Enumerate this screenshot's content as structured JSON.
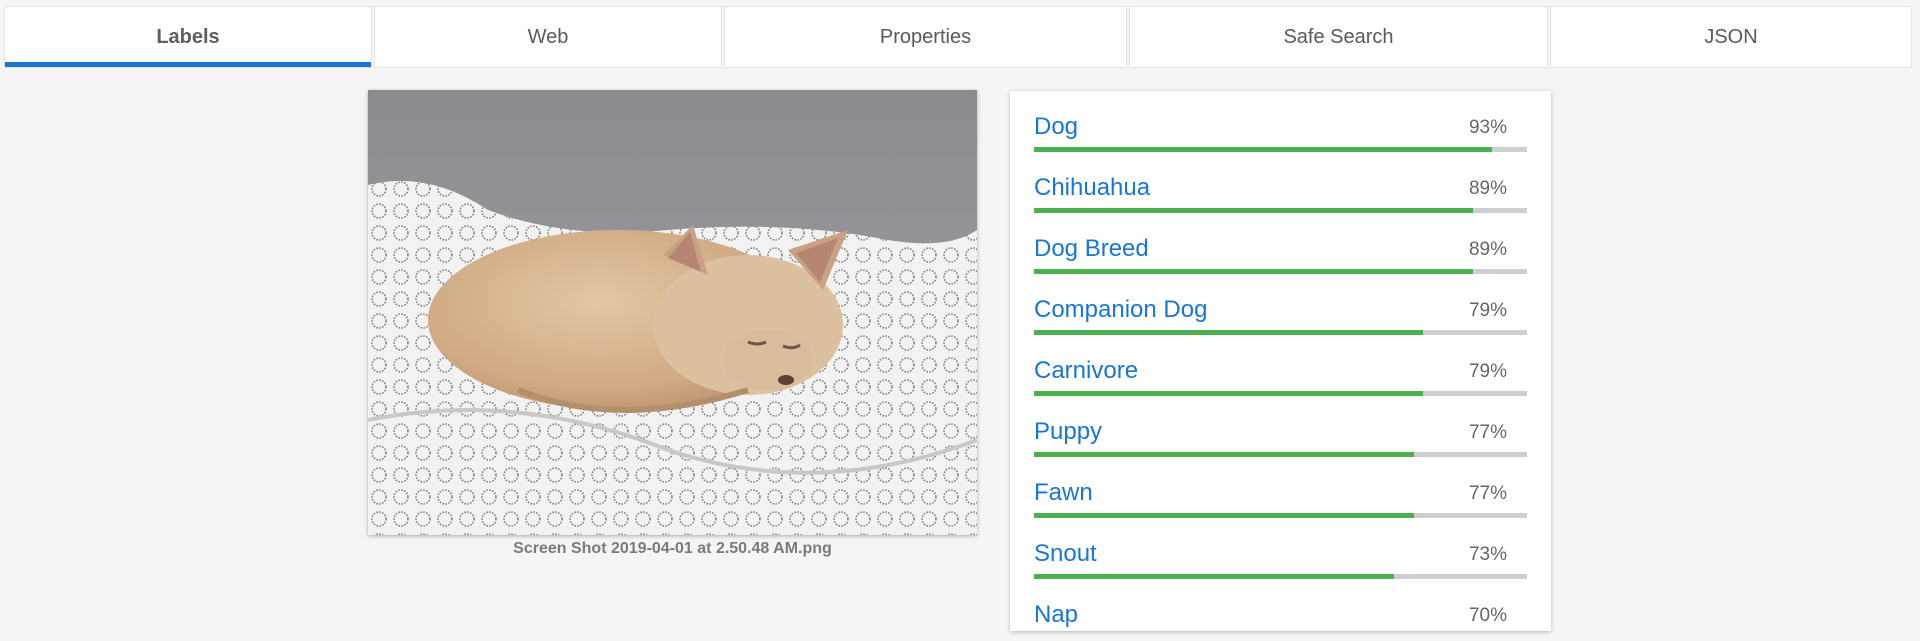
{
  "tabs": [
    {
      "label": "Labels",
      "active": true
    },
    {
      "label": "Web",
      "active": false
    },
    {
      "label": "Properties",
      "active": false
    },
    {
      "label": "Safe Search",
      "active": false
    },
    {
      "label": "JSON",
      "active": false
    }
  ],
  "image": {
    "caption": "Screen Shot 2019-04-01 at 2.50.48 AM.png"
  },
  "labels": [
    {
      "name": "Dog",
      "score_text": "93%",
      "score": 0.93
    },
    {
      "name": "Chihuahua",
      "score_text": "89%",
      "score": 0.89
    },
    {
      "name": "Dog Breed",
      "score_text": "89%",
      "score": 0.89
    },
    {
      "name": "Companion Dog",
      "score_text": "79%",
      "score": 0.79
    },
    {
      "name": "Carnivore",
      "score_text": "79%",
      "score": 0.79
    },
    {
      "name": "Puppy",
      "score_text": "77%",
      "score": 0.77
    },
    {
      "name": "Fawn",
      "score_text": "77%",
      "score": 0.77
    },
    {
      "name": "Snout",
      "score_text": "73%",
      "score": 0.73
    },
    {
      "name": "Nap",
      "score_text": "70%",
      "score": 0.7
    }
  ],
  "colors": {
    "accent": "#1976d2",
    "bar_fill": "#4caf50",
    "bar_track": "#cfcfcf"
  }
}
